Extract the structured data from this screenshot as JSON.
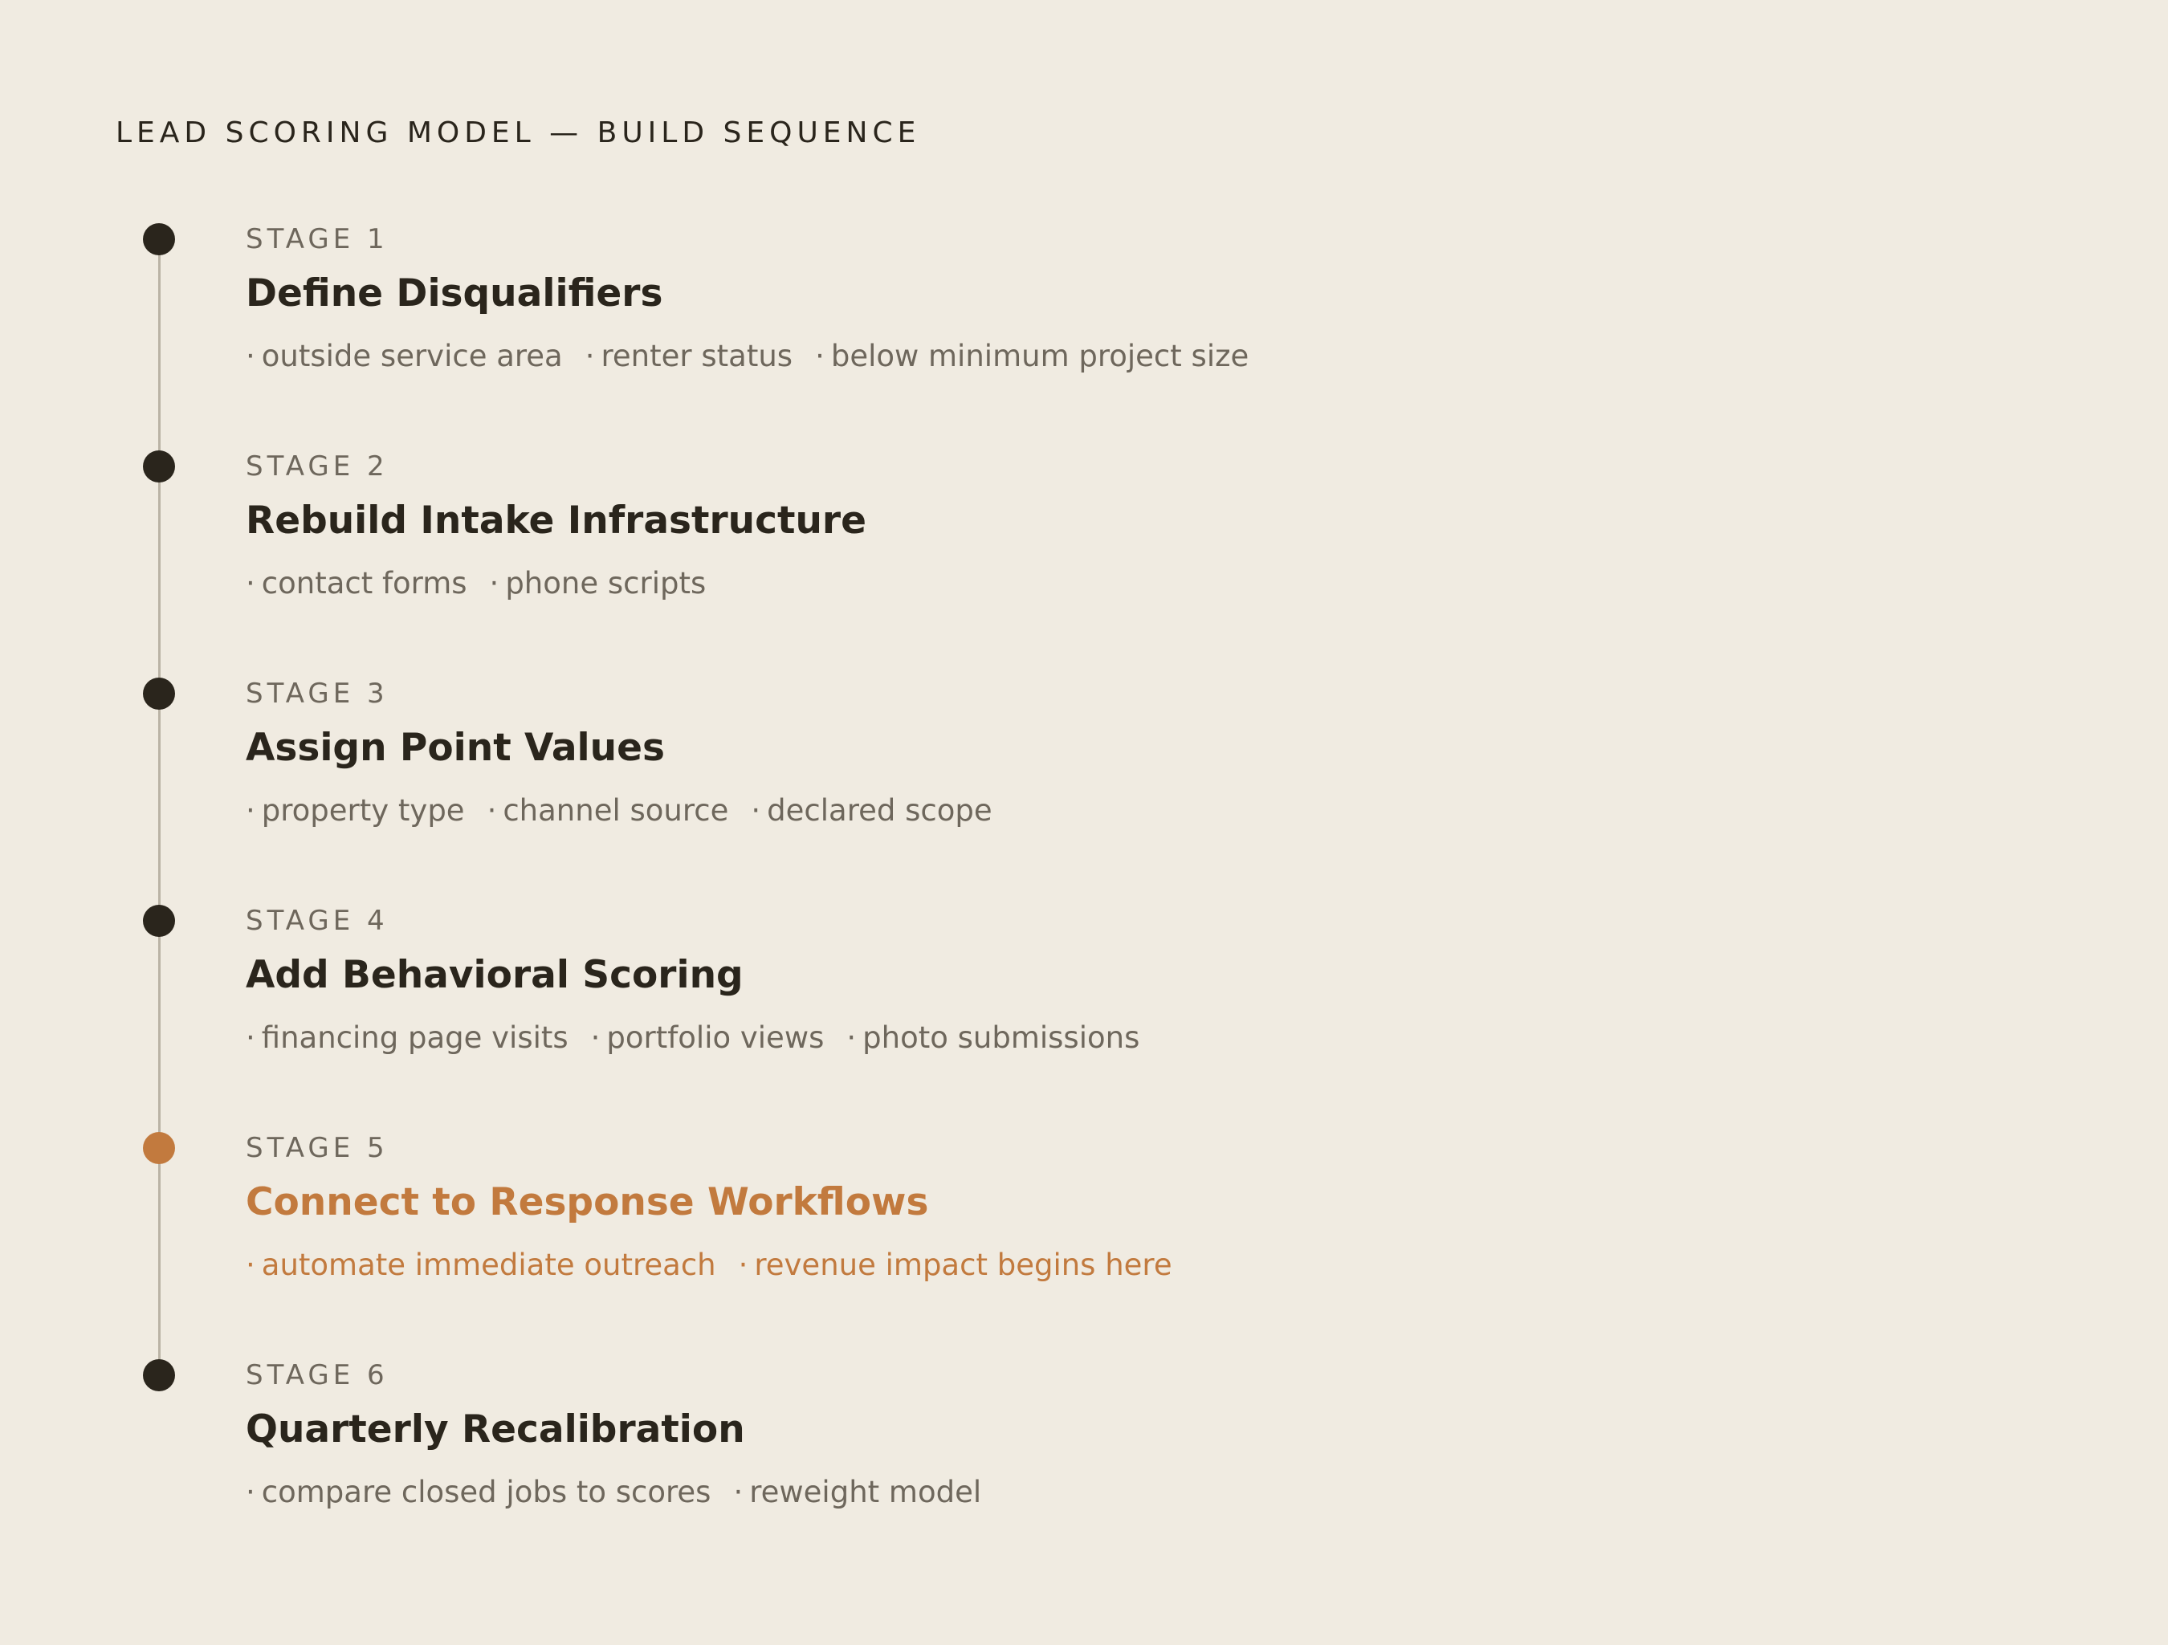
{
  "header": {
    "title": "LEAD SCORING MODEL — BUILD SEQUENCE"
  },
  "colors": {
    "background": "#f0ebe1",
    "text_primary": "#2a251c",
    "text_secondary": "#6e675c",
    "accent": "#c27a3e",
    "rail": "#bab3a5"
  },
  "stages": [
    {
      "label": "STAGE 1",
      "title": "Define Disqualifiers",
      "items": [
        "outside service area",
        "renter status",
        "below minimum project size"
      ],
      "highlighted": false
    },
    {
      "label": "STAGE 2",
      "title": "Rebuild Intake Infrastructure",
      "items": [
        "contact forms",
        "phone scripts"
      ],
      "highlighted": false
    },
    {
      "label": "STAGE 3",
      "title": "Assign Point Values",
      "items": [
        "property type",
        "channel source",
        "declared scope"
      ],
      "highlighted": false
    },
    {
      "label": "STAGE 4",
      "title": "Add Behavioral Scoring",
      "items": [
        "financing page visits",
        "portfolio views",
        "photo submissions"
      ],
      "highlighted": false
    },
    {
      "label": "STAGE 5",
      "title": "Connect to Response Workflows",
      "items": [
        "automate immediate outreach",
        "revenue impact begins here"
      ],
      "highlighted": true
    },
    {
      "label": "STAGE 6",
      "title": "Quarterly Recalibration",
      "items": [
        "compare closed jobs to scores",
        "reweight model"
      ],
      "highlighted": false
    }
  ]
}
